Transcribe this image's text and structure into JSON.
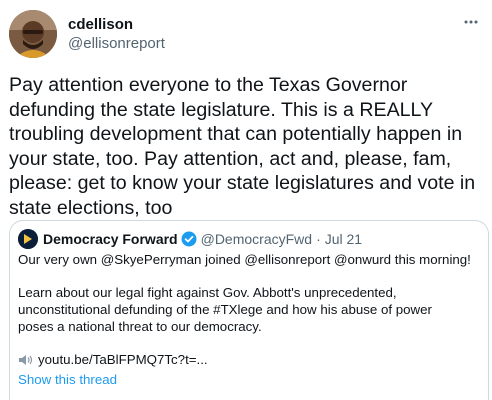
{
  "author": {
    "display_name": "cdellison",
    "handle": "@ellisonreport",
    "avatar_icon": "user-photo"
  },
  "menu_icon": "more-dots-icon",
  "tweet": {
    "text": "Pay attention everyone to the Texas Governor\ndefunding the state legislature. This is a REALLY\ntroubling development that can potentially happen in\nyour state, too. Pay attention, act and, please, fam,\nplease: get to know your state legislatures and vote in\nstate elections, too"
  },
  "quoted_tweet": {
    "display_name": "Democracy Forward",
    "verified": true,
    "handle": "@DemocracyFwd",
    "separator": "·",
    "time": "Jul 21",
    "lines": [
      "Our very own @SkyePerryman joined @ellisonreport @onwurd this morning!",
      "Learn about our legal fight against Gov. Abbott's unprecedented,",
      "unconstitutional defunding of the #TXlege and how his abuse of power",
      "poses a national threat to our democracy."
    ],
    "link": "youtu.be/TaBlFPMQ7Tc?t=...",
    "show_thread": "Show this thread"
  },
  "colors": {
    "text": "#0f1419",
    "secondary": "#536471",
    "link": "#1d9bf0",
    "border": "#cfd9de",
    "verified": "#1d9bf0"
  }
}
